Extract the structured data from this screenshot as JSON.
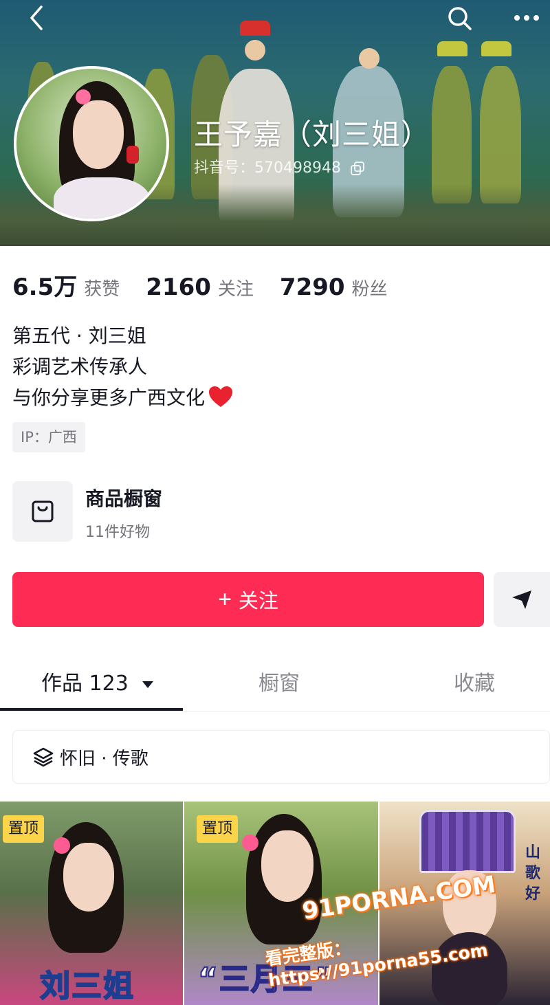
{
  "header": {
    "name": "王予嘉（刘三姐）",
    "douyin_id": "抖音号：570498948"
  },
  "stats": [
    {
      "value": "6.5万",
      "label": "获赞"
    },
    {
      "value": "2160",
      "label": "关注"
    },
    {
      "value": "7290",
      "label": "粉丝"
    }
  ],
  "bio": {
    "lines": [
      "第五代 · 刘三姐",
      "彩调艺术传承人",
      "与你分享更多广西文化"
    ]
  },
  "ip_location": "IP：广西",
  "shop_window": {
    "title": "商品橱窗",
    "subtitle": "11件好物"
  },
  "actions": {
    "follow_plus": "+",
    "follow_label": "关注"
  },
  "tabs": [
    {
      "label": "作品 123",
      "active": true
    },
    {
      "label": "橱窗",
      "active": false
    },
    {
      "label": "收藏",
      "active": false
    }
  ],
  "collection": {
    "label": "怀旧 · 传歌"
  },
  "videos": [
    {
      "badge": "置顶",
      "caption": "刘三姐"
    },
    {
      "badge": "置顶",
      "caption": "“三月三”"
    },
    {
      "badge": "",
      "caption": "",
      "side_text": "山歌好"
    }
  ],
  "watermark": {
    "logo": "91PORNA.COM",
    "url": "看完整版：https://91porna55.com"
  },
  "colors": {
    "accent": "#fe2c55",
    "pin_badge": "#fbd44a",
    "muted_text": "#75767c"
  },
  "icons": {
    "back": "chevron-left-icon",
    "search": "search-icon",
    "more": "more-dots-icon",
    "copy": "copy-icon",
    "heart": "heart-icon",
    "shop": "shopping-bag-icon",
    "direct_message": "send-icon",
    "caret": "caret-down-icon",
    "collection": "layers-icon"
  }
}
